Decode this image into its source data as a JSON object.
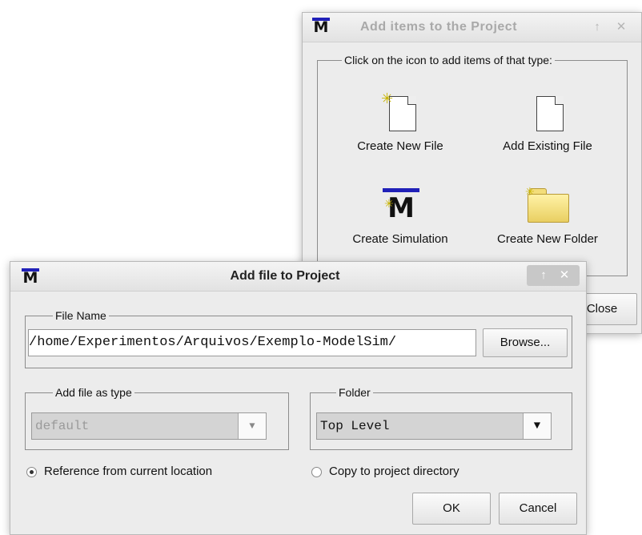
{
  "back_dialog": {
    "title": "Add items to the Project",
    "title_buttons": {
      "maximize": "↑",
      "close": "✕"
    },
    "group_label": "Click on the icon to add items of that type:",
    "items": [
      {
        "label": "Create New File",
        "icon": "new-file-icon"
      },
      {
        "label": "Add Existing File",
        "icon": "existing-file-icon"
      },
      {
        "label": "Create Simulation",
        "icon": "modelsim-m-icon"
      },
      {
        "label": "Create New Folder",
        "icon": "folder-icon"
      }
    ],
    "close_button": "Close"
  },
  "front_dialog": {
    "title": "Add file to Project",
    "title_buttons": {
      "maximize": "↑",
      "close": "✕"
    },
    "file_name": {
      "group_label": "File Name",
      "value": "/home/Experimentos/Arquivos/Exemplo-ModelSim/",
      "browse_button": "Browse..."
    },
    "file_type": {
      "group_label": "Add file as type",
      "selected": "default",
      "enabled": false
    },
    "folder": {
      "group_label": "Folder",
      "selected": "Top Level"
    },
    "options": [
      {
        "label": "Reference from current location",
        "checked": true
      },
      {
        "label": "Copy to project directory",
        "checked": false
      }
    ],
    "ok_button": "OK",
    "cancel_button": "Cancel"
  },
  "colors": {
    "modelsim_bar": "#2020b8",
    "folder": "#e9cf62",
    "window_bg": "#ececec"
  }
}
